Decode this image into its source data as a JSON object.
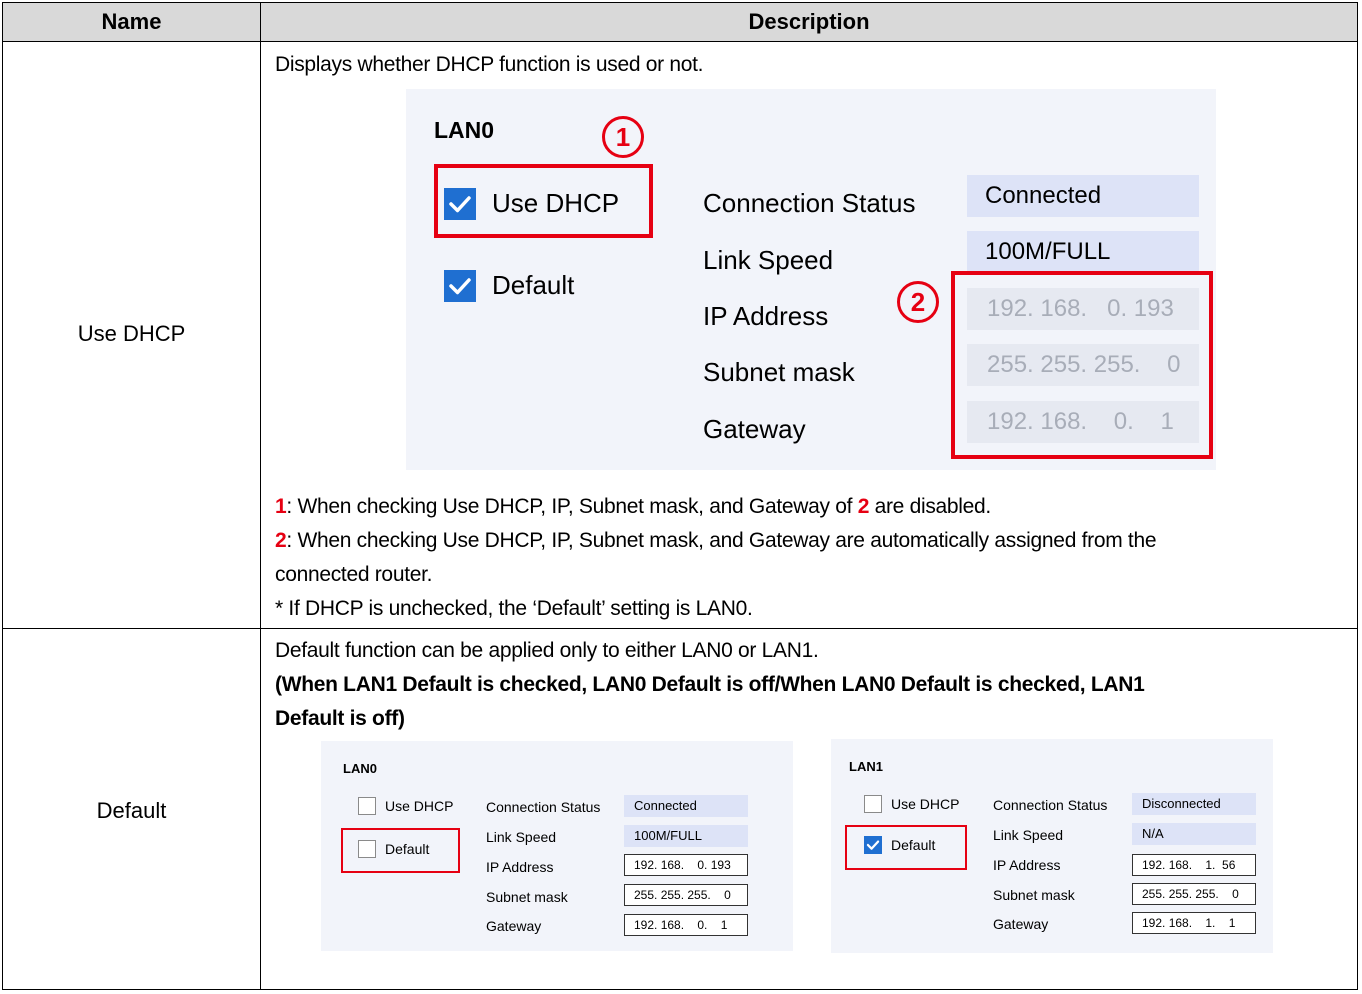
{
  "header": {
    "name": "Name",
    "description": "Description"
  },
  "rows": [
    {
      "name": "Use DHCP",
      "intro": "Displays whether DHCP function is used or not.",
      "panel": {
        "title": "LAN0",
        "use_dhcp_label": "Use DHCP",
        "default_label": "Default",
        "use_dhcp_checked": true,
        "default_checked": true,
        "fields": [
          {
            "label": "Connection Status",
            "value": "Connected"
          },
          {
            "label": "Link Speed",
            "value": "100M/FULL"
          },
          {
            "label": "IP Address",
            "value": "192. 168.   0. 193"
          },
          {
            "label": "Subnet mask",
            "value": "255. 255. 255.    0"
          },
          {
            "label": "Gateway",
            "value": "192. 168.    0.    1"
          }
        ],
        "marker_1": "1",
        "marker_2": "2"
      },
      "note1_num": "1",
      "note1_text": ": When checking Use DHCP, IP, Subnet mask, and Gateway of ",
      "note1_ref": "2",
      "note1_tail": " are disabled.",
      "note2_num": "2",
      "note2_text": ": When checking Use DHCP, IP, Subnet mask, and Gateway are automatically assigned from the",
      "note2_cont": "connected router.",
      "note3": "* If DHCP is unchecked, the ‘Default’ setting is LAN0."
    },
    {
      "name": "Default",
      "intro": "Default function can be applied only to either LAN0 or LAN1.",
      "bold_line1": "(When LAN1 Default is checked, LAN0 Default is off/When LAN0 Default is checked, LAN1",
      "bold_line2": "Default is off)",
      "lan0": {
        "title": "LAN0",
        "use_dhcp_label": "Use DHCP",
        "default_label": "Default",
        "fields": [
          {
            "label": "Connection Status",
            "value": "Connected"
          },
          {
            "label": "Link Speed",
            "value": "100M/FULL"
          },
          {
            "label": "IP Address",
            "value": "192. 168.    0. 193"
          },
          {
            "label": "Subnet mask",
            "value": "255. 255. 255.    0"
          },
          {
            "label": "Gateway",
            "value": "192. 168.    0.    1"
          }
        ]
      },
      "lan1": {
        "title": "LAN1",
        "use_dhcp_label": "Use DHCP",
        "default_label": "Default",
        "fields": [
          {
            "label": "Connection Status",
            "value": "Disconnected"
          },
          {
            "label": "Link Speed",
            "value": "N/A"
          },
          {
            "label": "IP Address",
            "value": "192. 168.    1.  56"
          },
          {
            "label": "Subnet mask",
            "value": "255. 255. 255.    0"
          },
          {
            "label": "Gateway",
            "value": "192. 168.    1.    1"
          }
        ]
      }
    }
  ],
  "colors": {
    "accent_red": "#e60012",
    "checkbox_blue": "#1f6fd1",
    "header_gray": "#d9d9d9"
  }
}
